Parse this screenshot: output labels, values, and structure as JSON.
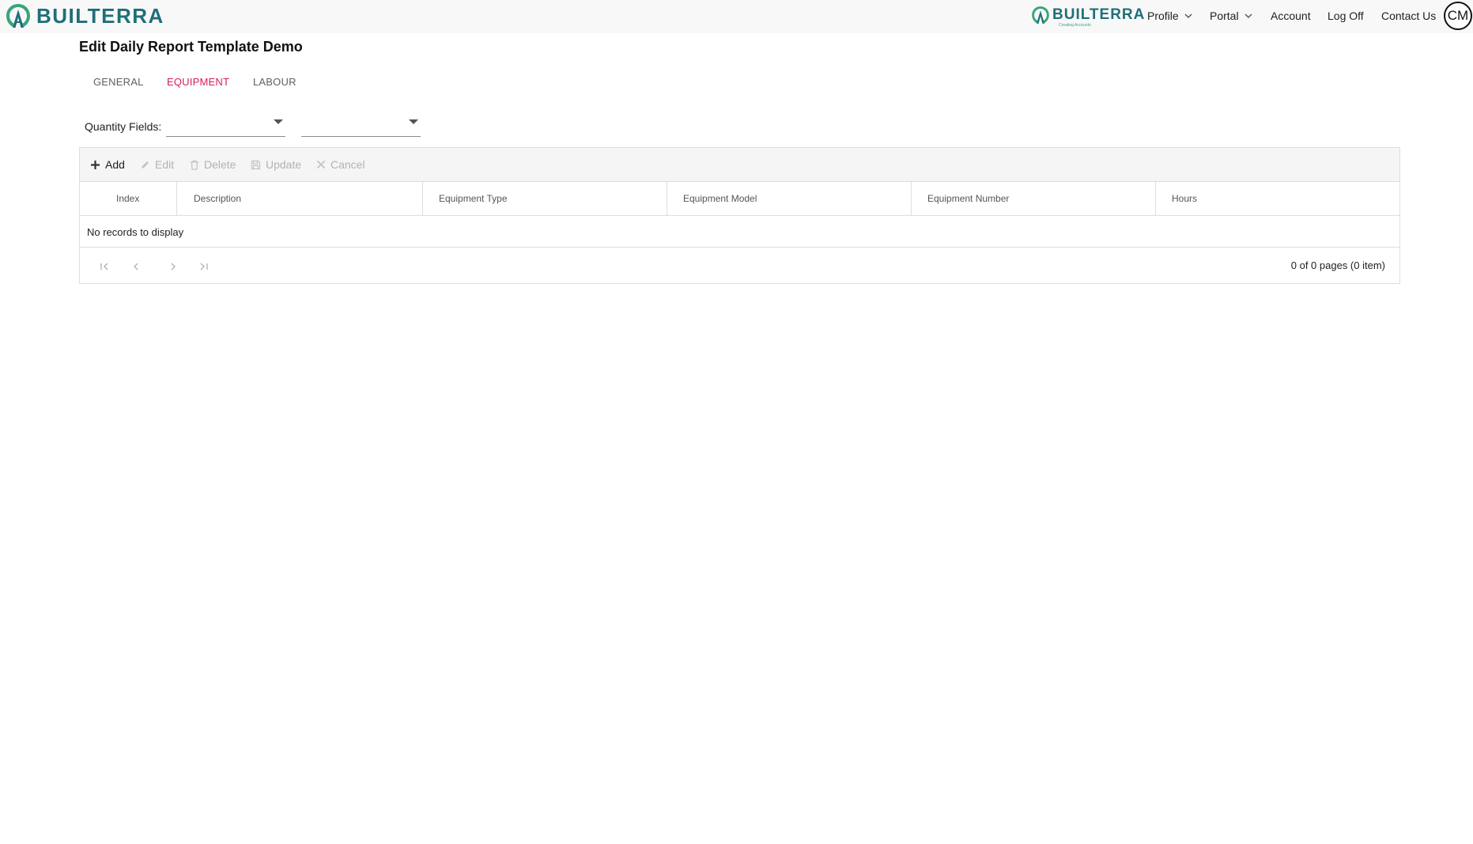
{
  "header": {
    "brand_text": "BUILTERRA",
    "brand_small_text": "BUILTERRA",
    "brand_small_sub": "Creating Accounts",
    "nav": {
      "profile": "Profile",
      "portal": "Portal",
      "account": "Account",
      "logoff": "Log Off",
      "contact": "Contact Us"
    },
    "avatar_initials": "CM"
  },
  "page": {
    "title": "Edit Daily Report Template Demo"
  },
  "tabs": [
    {
      "label": "GENERAL",
      "active": false
    },
    {
      "label": "EQUIPMENT",
      "active": true
    },
    {
      "label": "LABOUR",
      "active": false
    }
  ],
  "quantity": {
    "label": "Quantity Fields:",
    "select1_value": "",
    "select2_value": ""
  },
  "grid": {
    "toolbar": {
      "add": "Add",
      "edit": "Edit",
      "delete": "Delete",
      "update": "Update",
      "cancel": "Cancel"
    },
    "columns": [
      "Index",
      "Description",
      "Equipment Type",
      "Equipment Model",
      "Equipment Number",
      "Hours"
    ],
    "empty_text": "No records to display",
    "pager_info": "0 of 0 pages (0 item)"
  },
  "colors": {
    "brand": "#1f6f78",
    "brand_green": "#3aa57a",
    "tab_active": "#d81b60",
    "disabled": "#b3b3b3"
  },
  "icons": {
    "brand_logo": "builterra-logo-icon",
    "chevrons": "chevron-down-icon",
    "add": "plus-icon",
    "edit": "pencil-icon",
    "delete": "trash-icon",
    "update": "save-icon",
    "cancel": "close-icon",
    "pager": [
      "first-page-icon",
      "previous-page-icon",
      "next-page-icon",
      "last-page-icon"
    ]
  }
}
